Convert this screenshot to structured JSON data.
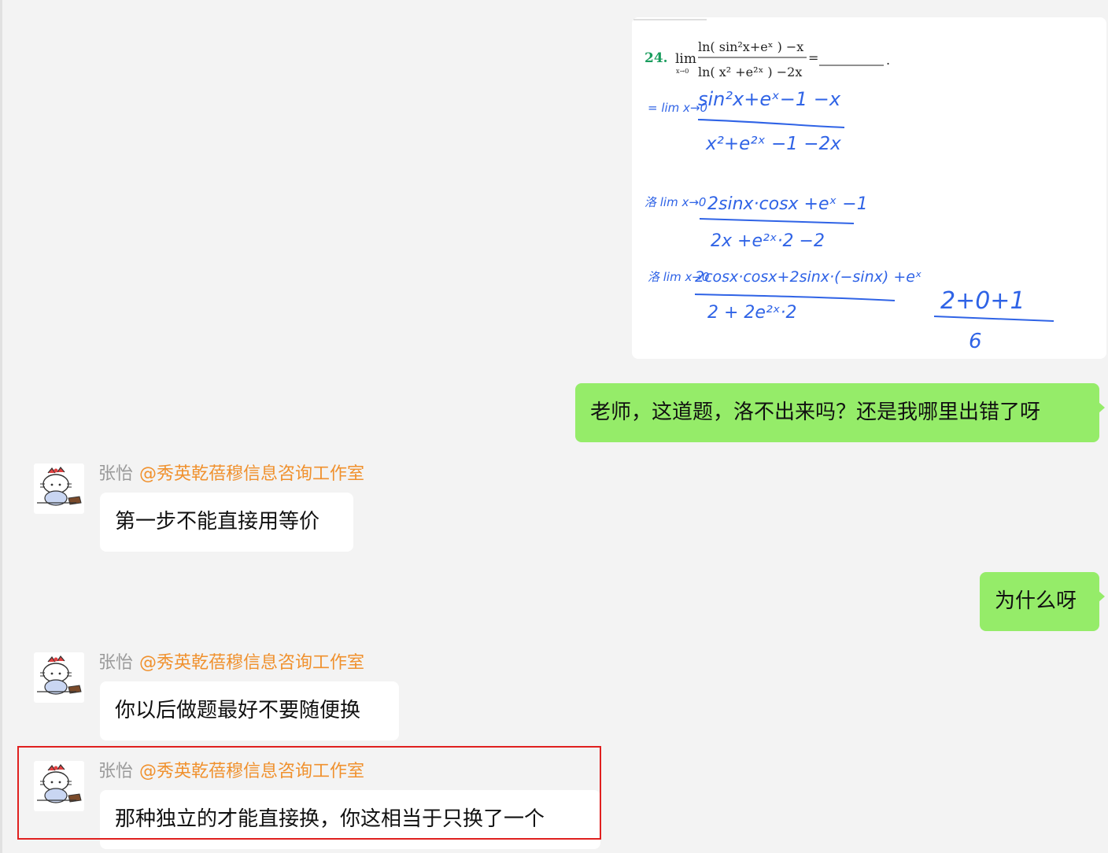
{
  "image_message": {
    "problem_number": "24.",
    "problem_lim": "lim",
    "problem_sub": "x→0",
    "problem_num": "ln( sin²x+eˣ ) −x",
    "problem_den": "ln( x² +e²ˣ ) −2x",
    "problem_eq": "=",
    "problem_tail": ".",
    "hw_step1_pre": "= lim x→0",
    "hw_step1_num": "sin²x+eˣ−1 −x",
    "hw_step1_den": "x²+e²ˣ −1 −2x",
    "hw_step2_pre": "洛 lim x→0",
    "hw_step2_num": "2sinx·cosx +eˣ −1",
    "hw_step2_den": "2x +e²ˣ·2 −2",
    "hw_step3_pre": "洛 lim x→0",
    "hw_step3_num": "2cosx·cosx+2sinx·(−sinx) +eˣ",
    "hw_step3_den": "2 + 2e²ˣ·2",
    "hw_result_num": "2+0+1",
    "hw_result_den": "6"
  },
  "messages": [
    {
      "direction": "out",
      "text": "老师，这道题，洛不出来吗？还是我哪里出错了呀"
    },
    {
      "direction": "in",
      "sender": "张怡",
      "group": "@秀英乾蓓穆信息咨询工作室",
      "text": "第一步不能直接用等价"
    },
    {
      "direction": "out",
      "text": "为什么呀"
    },
    {
      "direction": "in",
      "sender": "张怡",
      "group": "@秀英乾蓓穆信息咨询工作室",
      "text": "你以后做题最好不要随便换"
    },
    {
      "direction": "in",
      "sender": "张怡",
      "group": "@秀英乾蓓穆信息咨询工作室",
      "text": "那种独立的才能直接换，你这相当于只换了一个"
    }
  ],
  "colors": {
    "background": "#f3f3f3",
    "outgoing_bubble": "#95ec69",
    "incoming_bubble": "#ffffff",
    "group_name": "#f0912e",
    "sender_name": "#9a9a9a",
    "handwriting": "#2f63e6",
    "problem_number": "#1a9d5e",
    "highlight_border": "#e0201f"
  },
  "icons": {
    "avatar": "hello-kitty-avatar"
  }
}
